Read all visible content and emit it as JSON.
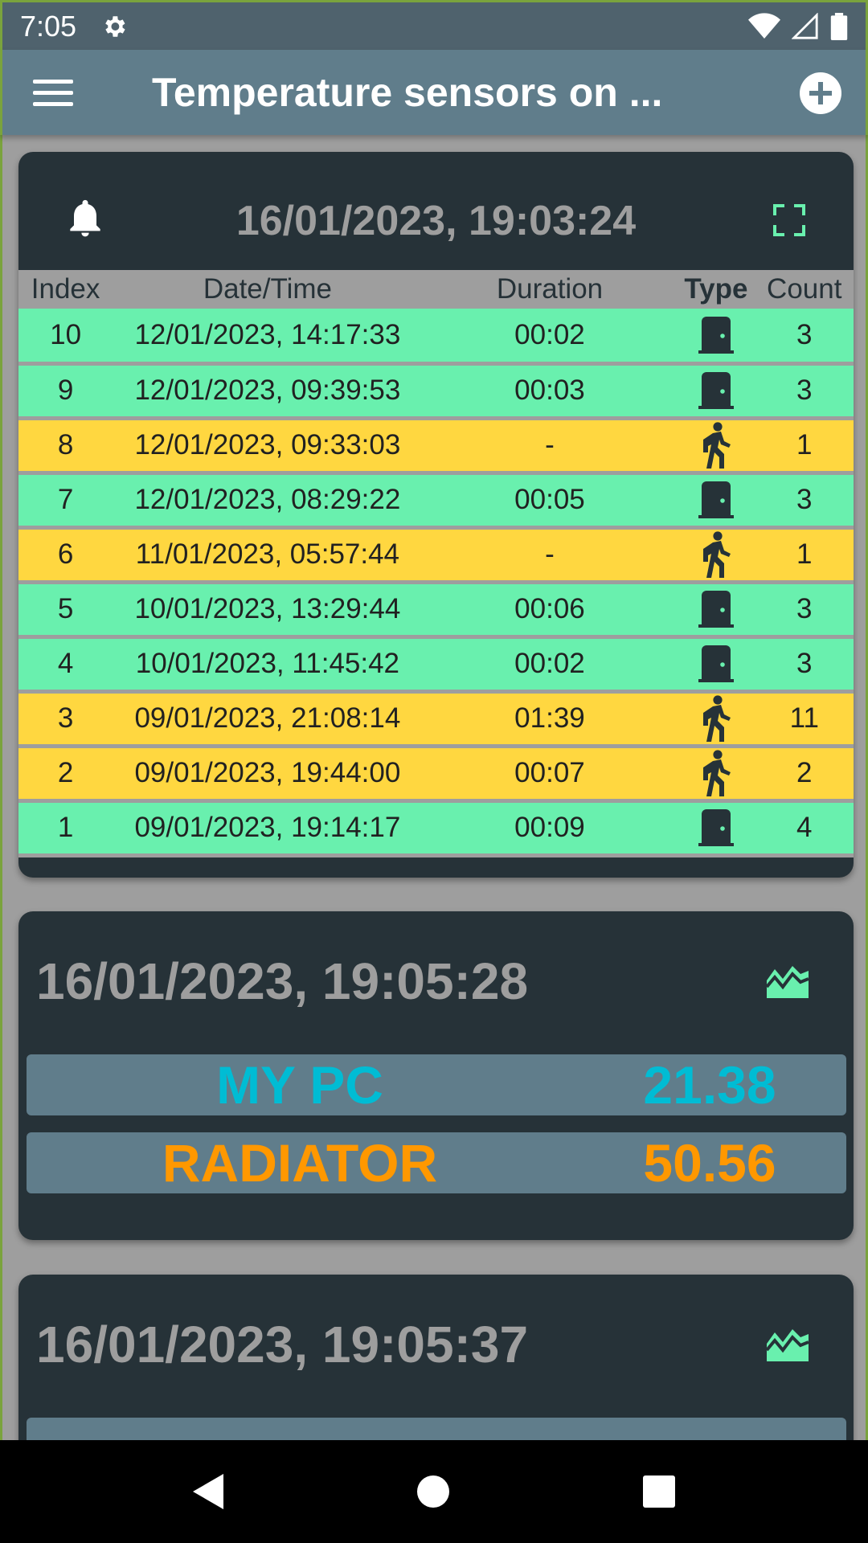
{
  "status_bar": {
    "time": "7:05"
  },
  "app_bar": {
    "title": "Temperature sensors on ..."
  },
  "alarm_card": {
    "timestamp": "16/01/2023, 19:03:24",
    "columns": [
      "Index",
      "Date/Time",
      "Duration",
      "Type",
      "Count"
    ],
    "rows": [
      {
        "index": "10",
        "datetime": "12/01/2023, 14:17:33",
        "duration": "00:02",
        "type": "door",
        "count": "3"
      },
      {
        "index": "9",
        "datetime": "12/01/2023, 09:39:53",
        "duration": "00:03",
        "type": "door",
        "count": "3"
      },
      {
        "index": "8",
        "datetime": "12/01/2023, 09:33:03",
        "duration": "-",
        "type": "walk",
        "count": "1"
      },
      {
        "index": "7",
        "datetime": "12/01/2023, 08:29:22",
        "duration": "00:05",
        "type": "door",
        "count": "3"
      },
      {
        "index": "6",
        "datetime": "11/01/2023, 05:57:44",
        "duration": "-",
        "type": "walk",
        "count": "1"
      },
      {
        "index": "5",
        "datetime": "10/01/2023, 13:29:44",
        "duration": "00:06",
        "type": "door",
        "count": "3"
      },
      {
        "index": "4",
        "datetime": "10/01/2023, 11:45:42",
        "duration": "00:02",
        "type": "door",
        "count": "3"
      },
      {
        "index": "3",
        "datetime": "09/01/2023, 21:08:14",
        "duration": "01:39",
        "type": "walk",
        "count": "11"
      },
      {
        "index": "2",
        "datetime": "09/01/2023, 19:44:00",
        "duration": "00:07",
        "type": "walk",
        "count": "2"
      },
      {
        "index": "1",
        "datetime": "09/01/2023, 19:14:17",
        "duration": "00:09",
        "type": "door",
        "count": "4"
      }
    ]
  },
  "sensor_card_1": {
    "timestamp": "16/01/2023, 19:05:28",
    "sensors": [
      {
        "name": "MY PC",
        "value": "21.38",
        "color": "#00bcd4"
      },
      {
        "name": "RADIATOR",
        "value": "50.56",
        "color": "#ff9800"
      }
    ]
  },
  "sensor_card_2": {
    "timestamp": "16/01/2023, 19:05:37"
  },
  "colors": {
    "door_row": "#69f0ae",
    "walk_row": "#ffd740",
    "app_bar": "#607d8b",
    "card": "#263238"
  }
}
